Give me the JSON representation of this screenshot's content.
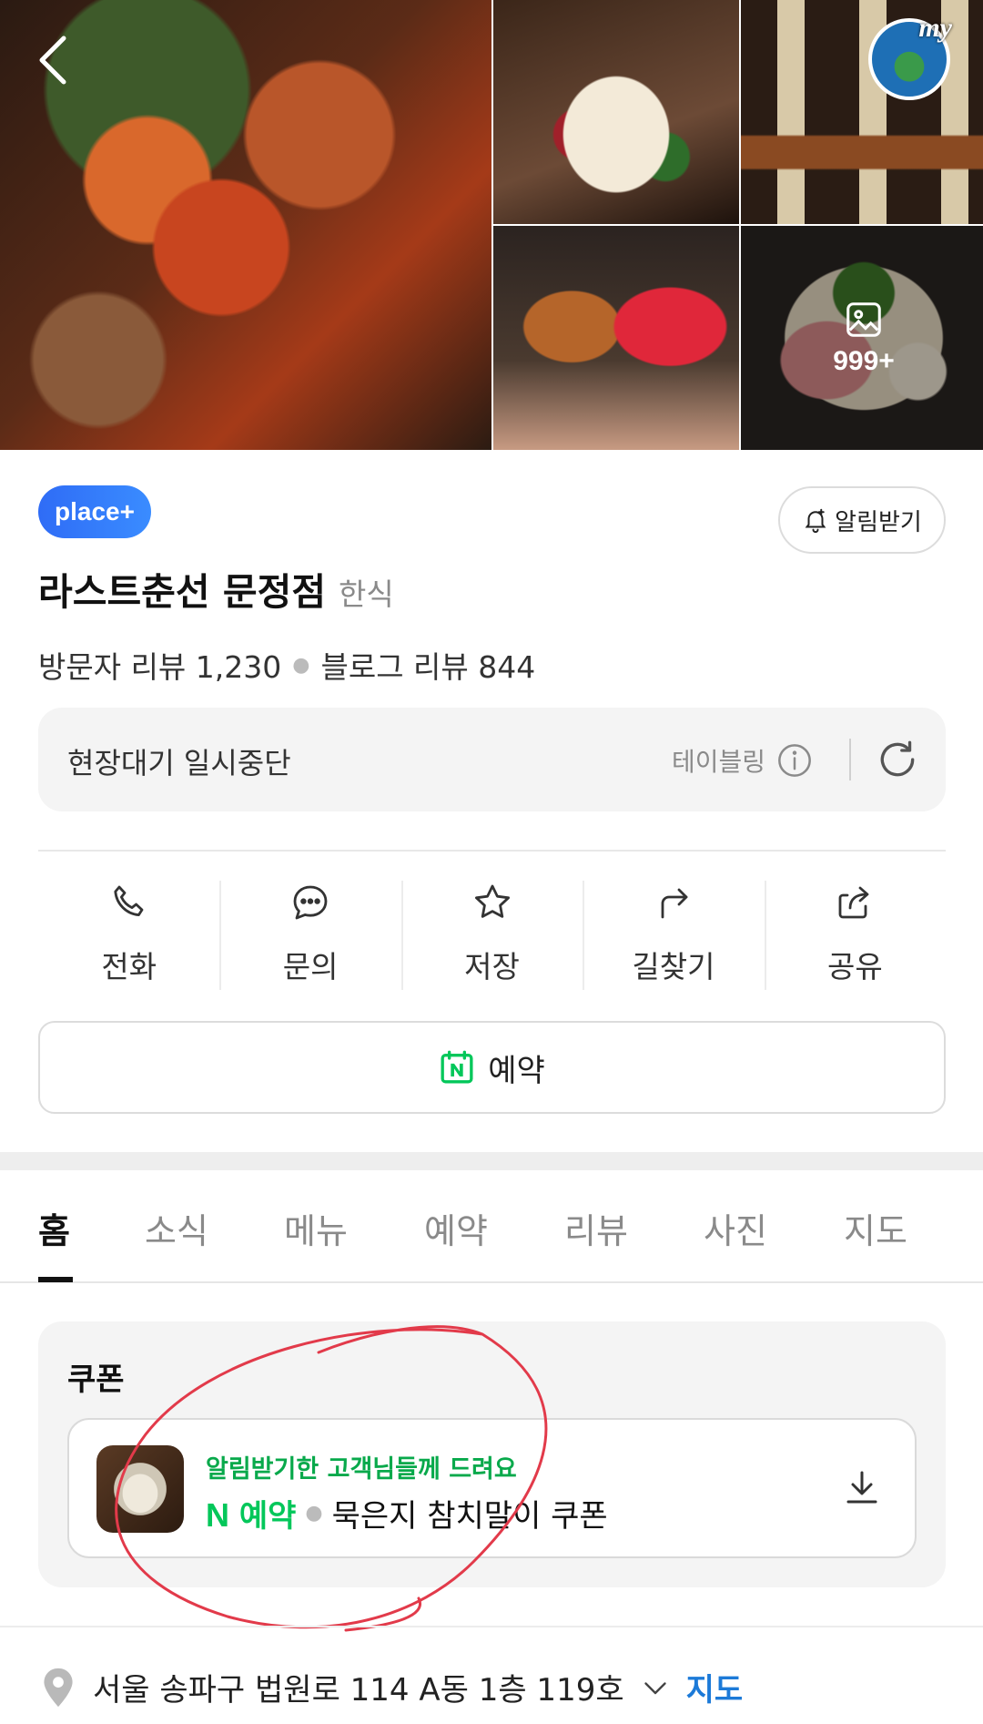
{
  "gallery": {
    "more_count": "999+",
    "my_badge": "my"
  },
  "header": {
    "place_badge": "place+",
    "notify_label": "알림받기",
    "title": "라스트춘선 문정점",
    "category": "한식",
    "visitor_reviews": "방문자 리뷰 1,230",
    "blog_reviews": "블로그 리뷰 844"
  },
  "wait": {
    "status": "현장대기 일시중단",
    "provider": "테이블링"
  },
  "actions": [
    {
      "label": "전화",
      "icon": "phone-icon"
    },
    {
      "label": "문의",
      "icon": "chat-icon"
    },
    {
      "label": "저장",
      "icon": "star-icon"
    },
    {
      "label": "길찾기",
      "icon": "directions-icon"
    },
    {
      "label": "공유",
      "icon": "share-icon"
    }
  ],
  "reserve": {
    "label": "예약"
  },
  "tabs": [
    "홈",
    "소식",
    "메뉴",
    "예약",
    "리뷰",
    "사진",
    "지도"
  ],
  "coupon": {
    "title": "쿠폰",
    "subtitle": "알림받기한 고객님들께 드려요",
    "brand_logo": "N",
    "brand_label": "예약",
    "name": "묵은지 참치말이 쿠폰"
  },
  "address": {
    "text": "서울 송파구 법원로 114 A동 1층 119호",
    "map_label": "지도"
  },
  "colors": {
    "brand_green": "#03c75a",
    "place_blue": "#2f6cf6",
    "link_blue": "#1c7ad8",
    "annotation_red": "#e23a4a"
  }
}
